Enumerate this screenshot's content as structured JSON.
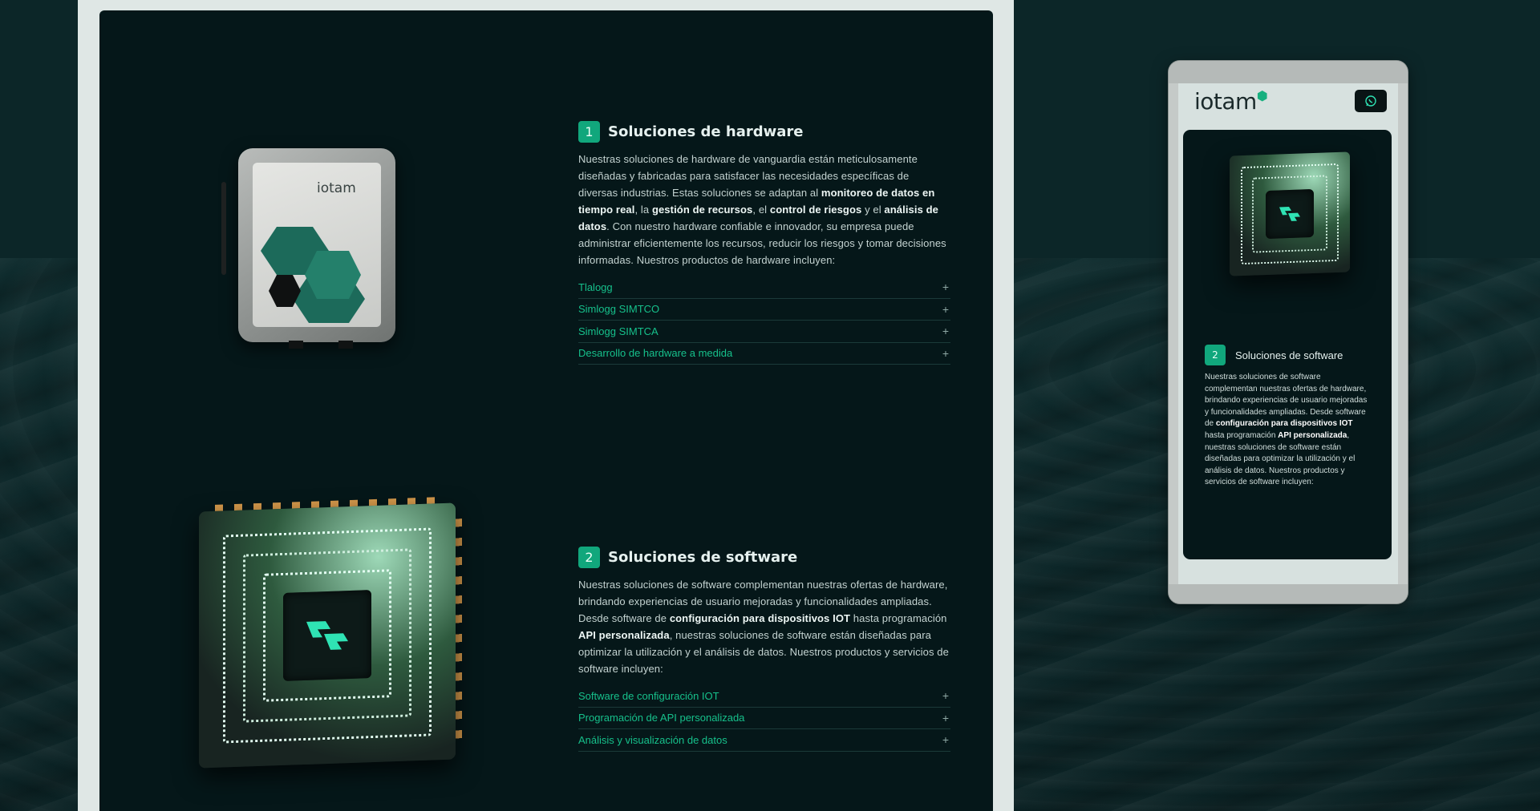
{
  "desktop": {
    "hardware": {
      "number": "1",
      "title": "Soluciones de hardware",
      "desc_parts": [
        "Nuestras soluciones de hardware de vanguardia están meticulosamente diseñadas y fabricadas para satisfacer las necesidades específicas de diversas industrias. Estas soluciones se adaptan al ",
        "monitoreo de datos en tiempo real",
        ", la ",
        "gestión de recursos",
        ", el ",
        "control de riesgos",
        " y el ",
        "análisis de datos",
        ". Con nuestro hardware confiable e innovador, su empresa puede administrar eficientemente los recursos, reducir los riesgos y tomar decisiones informadas. Nuestros productos de hardware incluyen:"
      ],
      "device_logo": "iotam",
      "items": [
        "Tlalogg",
        "Simlogg SIMTCO",
        "Simlogg SIMTCA",
        "Desarrollo de hardware a medida"
      ]
    },
    "software": {
      "number": "2",
      "title": "Soluciones de software",
      "desc_parts": [
        "Nuestras soluciones de software complementan nuestras ofertas de hardware, brindando experiencias de usuario mejoradas y funcionalidades ampliadas. Desde software de ",
        "configuración para dispositivos IOT",
        " hasta programación ",
        "API personalizada",
        ", nuestras soluciones de software están diseñadas para optimizar la utilización y el análisis de datos. Nuestros productos y servicios de software incluyen:"
      ],
      "items": [
        "Software de configuración IOT",
        "Programación de API personalizada",
        "Análisis y visualización de datos"
      ]
    },
    "accordion_icon": "plus-icon"
  },
  "mobile": {
    "brand": "iotam",
    "whatsapp_icon": "whatsapp-icon",
    "section": {
      "number": "2",
      "title": "Soluciones de software",
      "desc_parts": [
        "Nuestras soluciones de software complementan nuestras ofertas de hardware, brindando experiencias de usuario mejoradas y funcionalidades ampliadas. Desde software de ",
        "configuración para dispositivos IOT",
        " hasta programación ",
        "API personalizada",
        ", nuestras soluciones de software están diseñadas para optimizar la utilización y el análisis de datos. Nuestros productos y servicios de software incluyen:"
      ]
    }
  },
  "colors": {
    "accent": "#11a77c",
    "link": "#16c08b",
    "screen_bg": "#051719",
    "page_bg": "#0c2628"
  }
}
